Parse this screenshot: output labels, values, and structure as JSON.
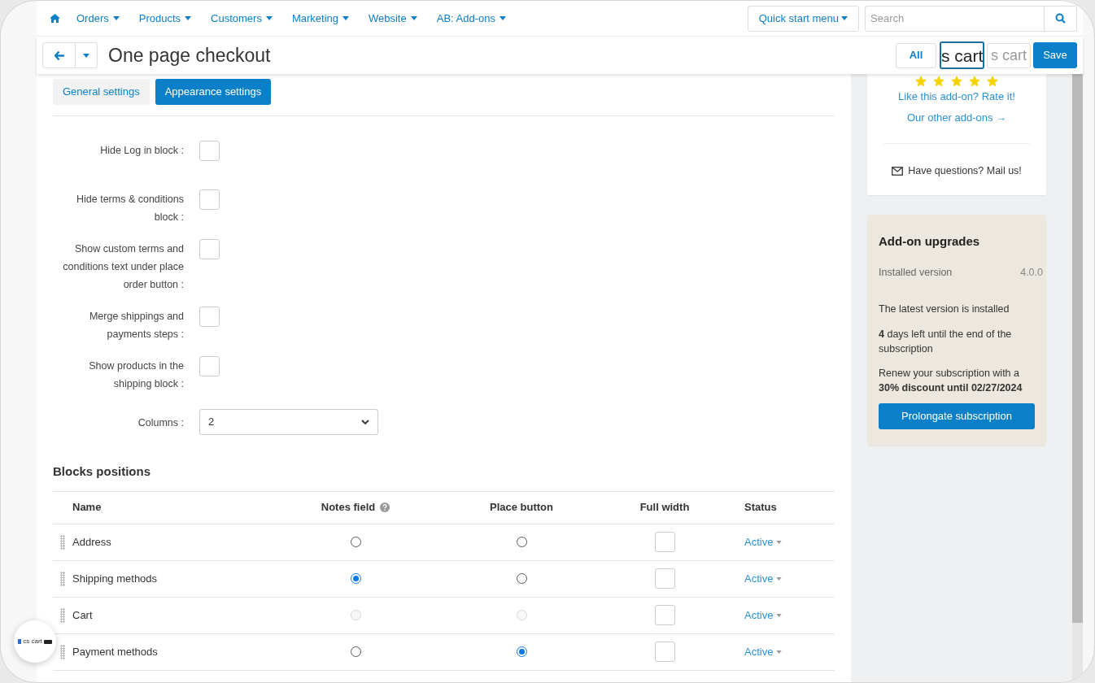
{
  "nav": {
    "items": [
      "Orders",
      "Products",
      "Customers",
      "Marketing",
      "Website",
      "AB: Add-ons"
    ],
    "quick_start": "Quick start menu",
    "search_placeholder": "Search"
  },
  "header": {
    "title": "One page checkout",
    "buttons": [
      {
        "label": "All",
        "kind": "outline"
      },
      {
        "label": "s cart",
        "kind": "focused"
      },
      {
        "label": "s cart",
        "kind": "faded"
      },
      {
        "label": "Save",
        "kind": "primary"
      }
    ]
  },
  "tabs": [
    {
      "label": "General settings",
      "selected": false
    },
    {
      "label": "Appearance settings",
      "selected": true
    }
  ],
  "settings": [
    {
      "kind": "checkbox",
      "label": "Hide Log in block :",
      "checked": false
    },
    {
      "kind": "checkbox",
      "label": "Hide terms & conditions block :",
      "checked": false
    },
    {
      "kind": "checkbox",
      "label": "Show custom terms and conditions text under place order button :",
      "checked": false
    },
    {
      "kind": "checkbox",
      "label": "Merge shippings and payments steps :",
      "checked": false
    },
    {
      "kind": "checkbox",
      "label": "Show products in the shipping block :",
      "checked": false
    },
    {
      "kind": "select",
      "label": "Columns :",
      "value": "2"
    }
  ],
  "blocks": {
    "title": "Blocks positions",
    "columns": [
      {
        "label": "Name"
      },
      {
        "label": "Notes field",
        "help": true
      },
      {
        "label": "Place button"
      },
      {
        "label": "Full width"
      },
      {
        "label": "Status"
      }
    ],
    "rows": [
      {
        "name": "Address",
        "notes": {
          "selected": false,
          "disabled": false
        },
        "place": {
          "selected": false,
          "disabled": false
        },
        "full_width": {
          "checked": false
        },
        "status": "Active"
      },
      {
        "name": "Shipping methods",
        "notes": {
          "selected": true,
          "disabled": false
        },
        "place": {
          "selected": false,
          "disabled": false
        },
        "full_width": {
          "checked": false
        },
        "status": "Active"
      },
      {
        "name": "Cart",
        "notes": {
          "selected": false,
          "disabled": true
        },
        "place": {
          "selected": false,
          "disabled": true
        },
        "full_width": {
          "checked": false
        },
        "status": "Active"
      },
      {
        "name": "Payment methods",
        "notes": {
          "selected": false,
          "disabled": false
        },
        "place": {
          "selected": true,
          "disabled": false
        },
        "full_width": {
          "checked": false
        },
        "status": "Active"
      }
    ]
  },
  "sidebar": {
    "stars": 5,
    "rate_link": "Like this add-on? Rate it!",
    "other_link": "Our other add-ons →",
    "mail": "Have questions? Mail us!",
    "upgrades": {
      "title": "Add-on upgrades",
      "installed_label": "Installed version",
      "installed_version": "4.0.0",
      "latest": "The latest version is installed",
      "days": "**4** days left until the end of the subscription",
      "renew": "Renew your subscription with a **30% discount until 02/27/2024**",
      "button": "Prolongate subscription"
    }
  },
  "badge": {
    "text": "cs cart"
  }
}
